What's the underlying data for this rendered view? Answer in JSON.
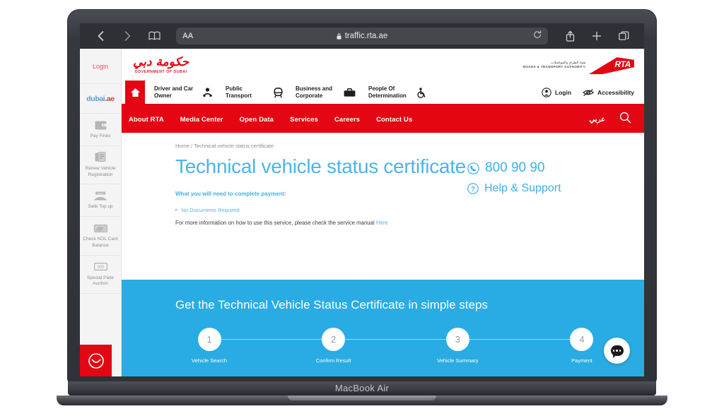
{
  "device": {
    "label": "MacBook Air"
  },
  "browser": {
    "back_icon": "chevron-left-icon",
    "forward_icon": "chevron-right-icon",
    "bookmarks_icon": "book-icon",
    "aa_label": "AA",
    "lock_icon": "lock-icon",
    "url": "traffic.rta.ae",
    "reload_icon": "reload-icon",
    "share_icon": "share-icon",
    "new_tab_icon": "plus-icon",
    "tabs_icon": "tabs-icon"
  },
  "quick_sidebar": {
    "login_label": "Login",
    "dubai_logo": "dubai",
    "dubai_logo_suffix": ".ae",
    "items": [
      {
        "icon": "wallet-icon",
        "label": "Pay Fines"
      },
      {
        "icon": "document-icon",
        "label": "Renew Vehicle Registration"
      },
      {
        "icon": "salik-gate-icon",
        "label": "Salik Top up"
      },
      {
        "icon": "nol-card-icon",
        "label": "Check NOL Card Balance"
      },
      {
        "icon": "plate-icon",
        "label": "Special Plate Auction"
      }
    ],
    "happiness_icon": "happiness-meter-smiley-icon"
  },
  "header": {
    "gov_logo_script": "حكومة دبي",
    "gov_logo_text": "GOVERNMENT OF DUBAI",
    "rta_arabic": "هيئة الطرق والمواصلات",
    "rta_english": "ROADS & TRANSPORT AUTHORITY",
    "rta_mark": "RTA"
  },
  "main_nav": {
    "home_icon": "home-icon",
    "items": [
      {
        "label": "Driver and Car Owner",
        "icon": "driver-icon"
      },
      {
        "label": "Public Transport",
        "icon": "metro-icon"
      },
      {
        "label": "Business and Corporate",
        "icon": "briefcase-icon"
      },
      {
        "label": "People Of Determination",
        "icon": "wheelchair-icon"
      }
    ],
    "right": [
      {
        "label": "Login",
        "icon": "user-circle-icon"
      },
      {
        "label": "Accessibility",
        "icon": "eye-accessibility-icon"
      }
    ]
  },
  "menu_bar": {
    "items": [
      "About RTA",
      "Media Center",
      "Open Data",
      "Services",
      "Careers",
      "Contact Us"
    ],
    "arabic_label": "عربي",
    "search_icon": "search-icon"
  },
  "content": {
    "breadcrumb": "Home / Technical vehicle status certificate",
    "title": "Technical vehicle status certificate",
    "need_title": "What you will need to complete payment:",
    "documents_required": "No Documents Required",
    "more_info_text": "For more information on how to use this service, please check the service manual",
    "more_info_link": "Here",
    "phone_icon": "phone-icon",
    "phone": "800 90 90",
    "help_icon": "question-circle-icon",
    "help_label": "Help & Support"
  },
  "steps_section": {
    "title": "Get the Technical Vehicle Status Certificate in simple steps",
    "steps": [
      {
        "number": "1",
        "label": "Vehicle Search"
      },
      {
        "number": "2",
        "label": "Confirm Result"
      },
      {
        "number": "3",
        "label": "Vehicle Summary"
      },
      {
        "number": "4",
        "label": "Payment"
      }
    ]
  },
  "chat": {
    "icon": "chat-bubble-icon"
  },
  "colors": {
    "rta_red": "#e30613",
    "accent_blue": "#29ace3",
    "title_blue": "#4fb3e8"
  }
}
